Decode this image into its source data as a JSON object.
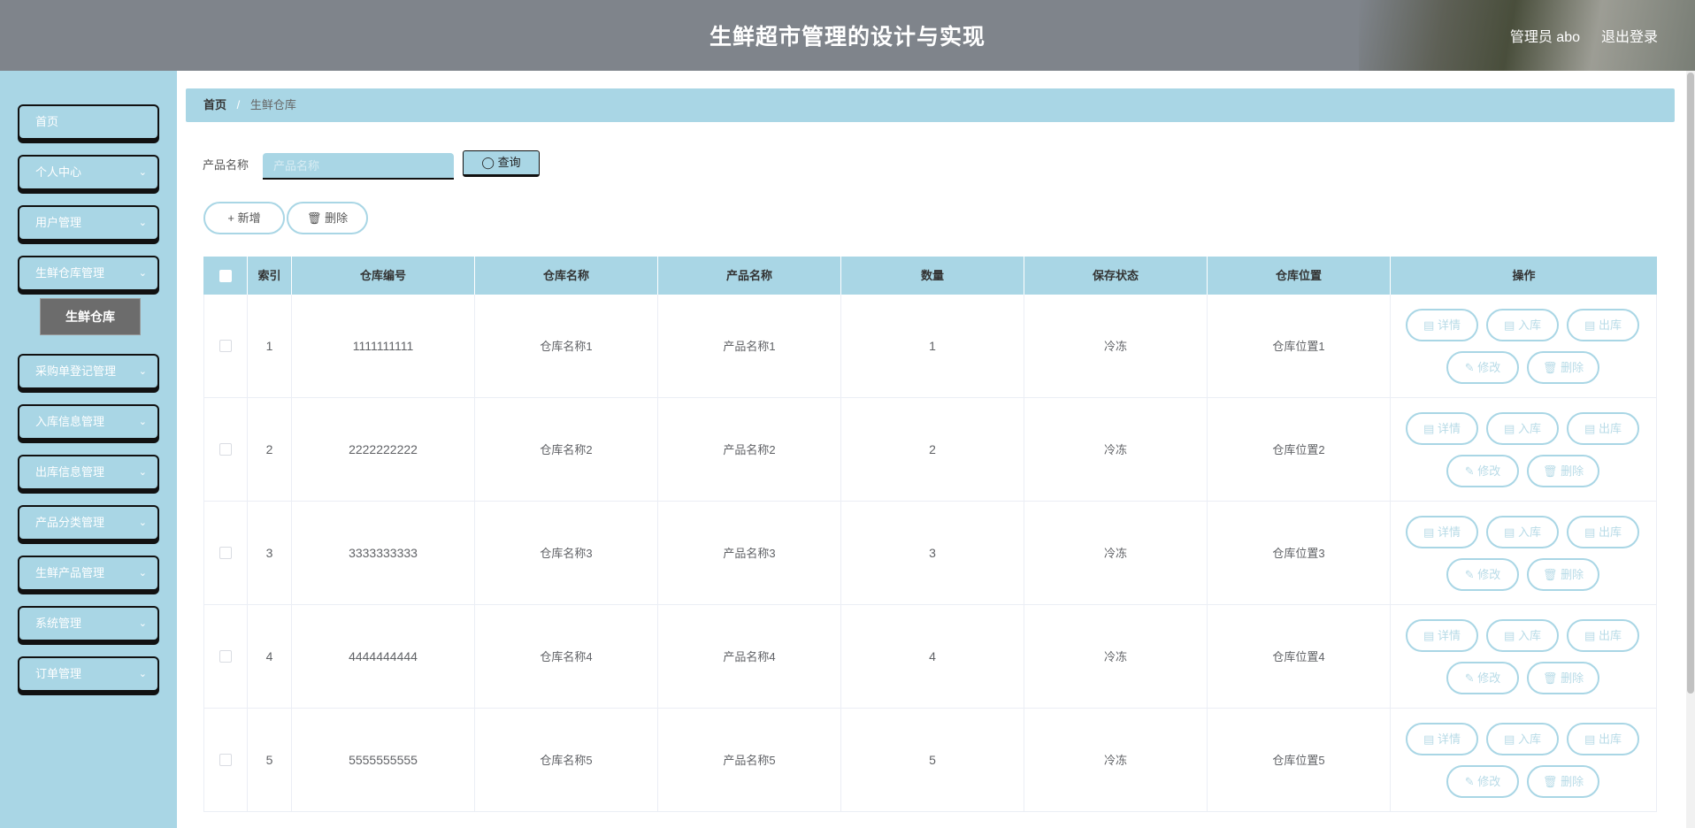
{
  "header": {
    "title": "生鲜超市管理的设计与实现",
    "user": "管理员 abo",
    "logout": "退出登录"
  },
  "sidebar": {
    "items": [
      {
        "label": "首页",
        "has_children": false
      },
      {
        "label": "个人中心",
        "has_children": true
      },
      {
        "label": "用户管理",
        "has_children": true
      },
      {
        "label": "生鲜仓库管理",
        "has_children": true
      },
      {
        "label": "采购单登记管理",
        "has_children": true
      },
      {
        "label": "入库信息管理",
        "has_children": true
      },
      {
        "label": "出库信息管理",
        "has_children": true
      },
      {
        "label": "产品分类管理",
        "has_children": true
      },
      {
        "label": "生鲜产品管理",
        "has_children": true
      },
      {
        "label": "系统管理",
        "has_children": true
      },
      {
        "label": "订单管理",
        "has_children": true
      }
    ],
    "sub_active": "生鲜仓库"
  },
  "breadcrumb": {
    "home": "首页",
    "separator": "/",
    "current": "生鲜仓库"
  },
  "search": {
    "label": "产品名称",
    "placeholder": "产品名称",
    "value": "",
    "button": "查询"
  },
  "toolbar": {
    "add": "新增",
    "delete": "删除"
  },
  "table": {
    "columns": [
      "索引",
      "仓库编号",
      "仓库名称",
      "产品名称",
      "数量",
      "保存状态",
      "仓库位置",
      "操作"
    ],
    "rows": [
      {
        "index": "1",
        "code": "1111111111",
        "warehouse": "仓库名称1",
        "product": "产品名称1",
        "qty": "1",
        "status": "冷冻",
        "location": "仓库位置1"
      },
      {
        "index": "2",
        "code": "2222222222",
        "warehouse": "仓库名称2",
        "product": "产品名称2",
        "qty": "2",
        "status": "冷冻",
        "location": "仓库位置2"
      },
      {
        "index": "3",
        "code": "3333333333",
        "warehouse": "仓库名称3",
        "product": "产品名称3",
        "qty": "3",
        "status": "冷冻",
        "location": "仓库位置3"
      },
      {
        "index": "4",
        "code": "4444444444",
        "warehouse": "仓库名称4",
        "product": "产品名称4",
        "qty": "4",
        "status": "冷冻",
        "location": "仓库位置4"
      },
      {
        "index": "5",
        "code": "5555555555",
        "warehouse": "仓库名称5",
        "product": "产品名称5",
        "qty": "5",
        "status": "冷冻",
        "location": "仓库位置5"
      }
    ],
    "actions": {
      "detail": "详情",
      "stock_in": "入库",
      "stock_out": "出库",
      "edit": "修改",
      "delete": "删除"
    }
  },
  "colors": {
    "accent": "#a9d6e5",
    "header": "#7f848b",
    "sub_active": "#6c6c6c"
  }
}
